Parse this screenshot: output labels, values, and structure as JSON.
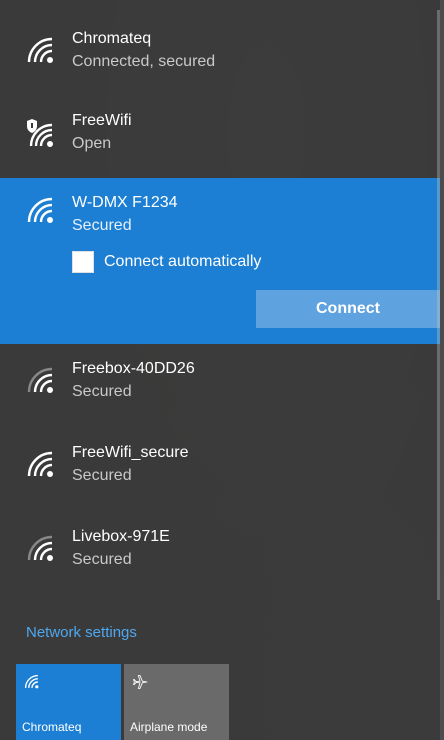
{
  "networks": [
    {
      "name": "Chromateq",
      "status": "Connected, secured",
      "icon": "wifi-icon"
    },
    {
      "name": "FreeWifi",
      "status": "Open",
      "icon": "wifi-shield-icon"
    },
    {
      "name": "W-DMX F1234",
      "status": "Secured",
      "icon": "wifi-icon",
      "selected": true,
      "connect_automatically_label": "Connect automatically",
      "connect_automatically_checked": false,
      "connect_button_label": "Connect"
    },
    {
      "name": "Freebox-40DD26",
      "status": "Secured",
      "icon": "wifi-icon"
    },
    {
      "name": "FreeWifi_secure",
      "status": "Secured",
      "icon": "wifi-icon"
    },
    {
      "name": "Livebox-971E",
      "status": "Secured",
      "icon": "wifi-icon"
    }
  ],
  "network_settings_label": "Network settings",
  "quick_actions": [
    {
      "label": "Chromateq",
      "icon": "wifi-icon",
      "active": true
    },
    {
      "label": "Airplane mode",
      "icon": "airplane-icon",
      "active": false
    }
  ],
  "colors": {
    "accent": "#1c7fd3",
    "link": "#4ea8ef",
    "panel": "#383838"
  }
}
